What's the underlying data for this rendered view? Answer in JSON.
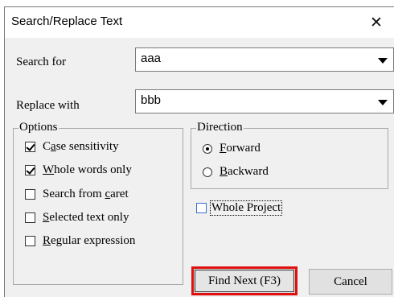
{
  "dialog": {
    "title": "Search/Replace Text",
    "close_glyph": "✕"
  },
  "search": {
    "label_prefix": "Search for",
    "value": "aaa"
  },
  "replace": {
    "label": "Replace with",
    "value": "bbb"
  },
  "options": {
    "legend": "Options",
    "items": [
      {
        "pre": "C",
        "u": "a",
        "post": "se sensitivity",
        "checked": true
      },
      {
        "pre": "",
        "u": "W",
        "post": "hole words only",
        "checked": true
      },
      {
        "pre": "Search from ",
        "u": "c",
        "post": "aret",
        "checked": false
      },
      {
        "pre": "",
        "u": "S",
        "post": "elected text only",
        "checked": false
      },
      {
        "pre": "",
        "u": "R",
        "post": "egular expression",
        "checked": false
      }
    ]
  },
  "direction": {
    "legend": "Direction",
    "forward": {
      "u": "F",
      "post": "orward",
      "selected": true
    },
    "backward": {
      "u": "B",
      "post": "ackward",
      "selected": false
    }
  },
  "whole_project": {
    "label": "Whole Project",
    "checked": false
  },
  "buttons": {
    "find_next": "Find Next (F3)",
    "cancel": "Cancel"
  },
  "icons": {
    "close": "close-icon",
    "dropdown": "chevron-down-icon"
  },
  "colors": {
    "highlight": "#e01010",
    "dialog_bg": "#f0f0f0",
    "checkbox_border_blue": "#3b6fd0"
  }
}
